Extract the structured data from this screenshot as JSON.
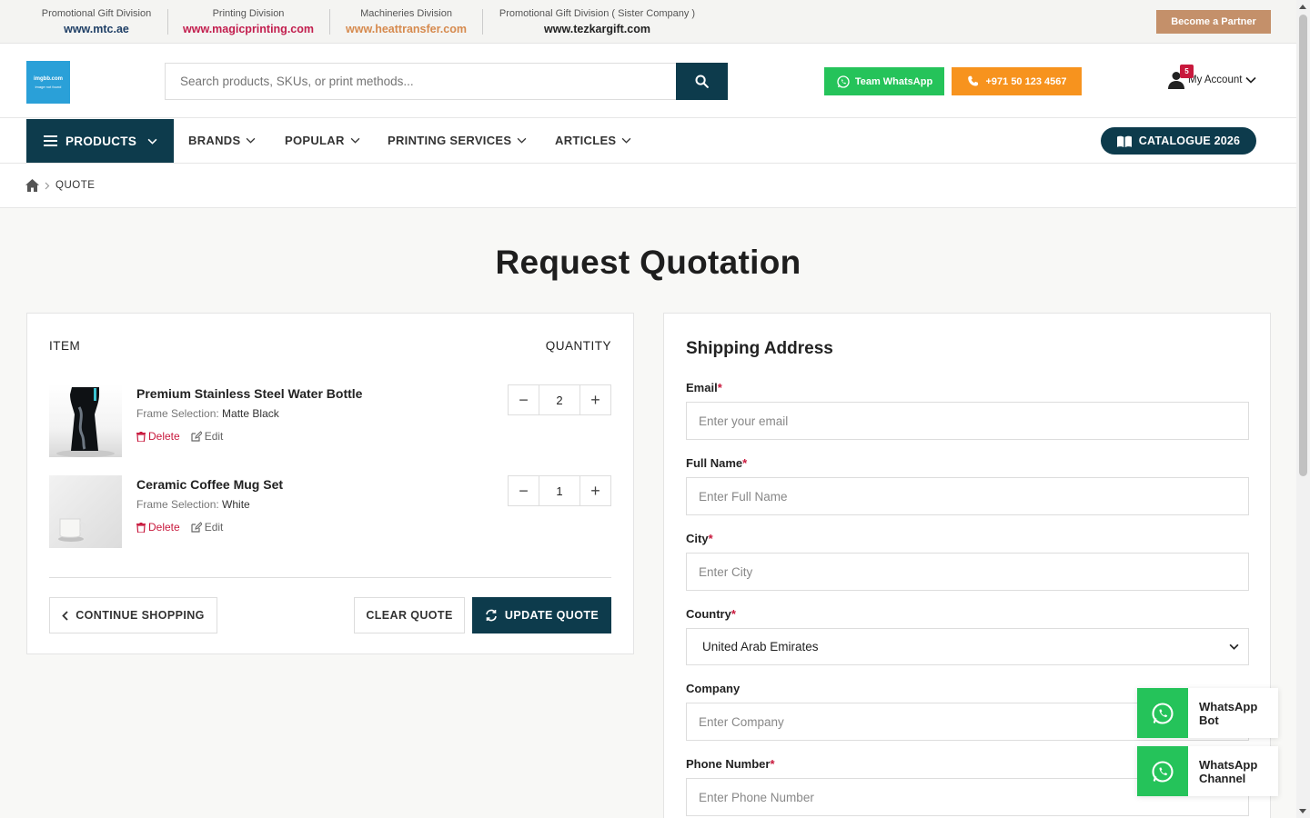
{
  "divisions": [
    {
      "label": "Promotional Gift Division",
      "url": "www.mtc.ae",
      "color": "#1f3f66"
    },
    {
      "label": "Printing Division",
      "url": "www.magicprinting.com",
      "color": "#c21e4e"
    },
    {
      "label": "Machineries Division",
      "url": "www.heattransfer.com",
      "color": "#d68a4e"
    },
    {
      "label": "Promotional Gift Division ( Sister Company )",
      "url": "www.tezkargift.com",
      "color": "#222222"
    }
  ],
  "partner_label": "Become a Partner",
  "logo": {
    "line1": "imgbb.com",
    "line2": "image not found"
  },
  "search": {
    "placeholder": "Search products, SKUs, or print methods..."
  },
  "whatsapp_label": "Team WhatsApp",
  "phone_label": "+971 50 123 4567",
  "account": {
    "label": "My Account",
    "badge": "5"
  },
  "nav": {
    "products": "PRODUCTS",
    "items": [
      "BRANDS",
      "POPULAR",
      "PRINTING SERVICES",
      "ARTICLES"
    ],
    "catalogue": "CATALOGUE 2026"
  },
  "breadcrumb": {
    "current": "QUOTE"
  },
  "page_title": "Request Quotation",
  "cart": {
    "col_item": "ITEM",
    "col_qty": "QUANTITY",
    "items": [
      {
        "name": "Premium Stainless Steel Water Bottle",
        "option_label": "Frame Selection:",
        "option_value": "Matte Black",
        "qty": "2"
      },
      {
        "name": "Ceramic Coffee Mug Set",
        "option_label": "Frame Selection:",
        "option_value": "White",
        "qty": "1"
      }
    ],
    "delete_label": "Delete",
    "edit_label": "Edit",
    "continue_label": "CONTINUE SHOPPING",
    "clear_label": "CLEAR QUOTE",
    "update_label": "UPDATE QUOTE"
  },
  "shipping": {
    "title": "Shipping Address",
    "email": {
      "label": "Email",
      "placeholder": "Enter your email"
    },
    "full_name": {
      "label": "Full Name",
      "placeholder": "Enter Full Name"
    },
    "city": {
      "label": "City",
      "placeholder": "Enter City"
    },
    "country": {
      "label": "Country",
      "value": "United Arab Emirates"
    },
    "company": {
      "label": "Company",
      "placeholder": "Enter Company"
    },
    "phone": {
      "label": "Phone Number",
      "placeholder": "Enter Phone Number"
    },
    "required_mark": "*"
  },
  "float_buttons": [
    {
      "label": "WhatsApp\nBot"
    },
    {
      "label": "WhatsApp\nChannel"
    }
  ],
  "colors": {
    "primary": "#0d3b4c",
    "whatsapp": "#25c35a",
    "phone": "#f7931e",
    "partner": "#c4906a",
    "danger": "#c8183c"
  }
}
